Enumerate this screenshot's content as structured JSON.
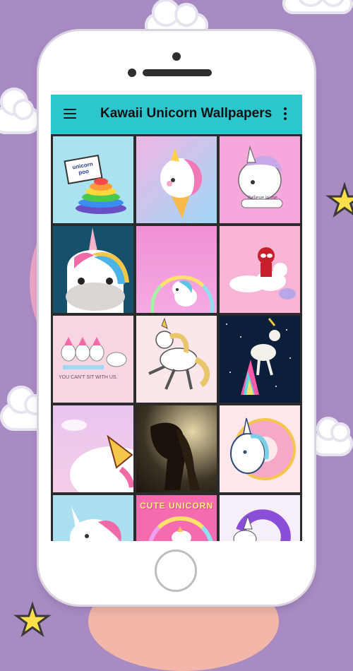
{
  "app": {
    "title": "Kawaii Unicorn Wallpapers"
  },
  "icons": {
    "menu": "hamburger-menu-icon",
    "more": "more-vert-icon"
  },
  "colors": {
    "background": "#a98bc4",
    "appbar": "#2cc6cf",
    "phone": "#ffffff"
  },
  "wallpapers": [
    {
      "name": "unicorn-poo",
      "sign_line1": "unicorn",
      "sign_line2": "poo",
      "bg": "#a9e3f0"
    },
    {
      "name": "unicorn-ice-cream",
      "bg": "#cfc4f2"
    },
    {
      "name": "unicorn-believe",
      "caption": "Believe in me",
      "bg": "#f6a7dc"
    },
    {
      "name": "unicorn-face-rainbow-mane",
      "bg": "#16506b"
    },
    {
      "name": "baby-unicorn-rainbow",
      "bg": "#f191d4"
    },
    {
      "name": "deadpool-unicorn",
      "bg": "#f8b4d5"
    },
    {
      "name": "unicorn-squad",
      "caption": "YOU CAN'T SIT WITH US.",
      "bg": "#f8d5e3"
    },
    {
      "name": "dancing-unicorn",
      "bg": "#fbe6ea"
    },
    {
      "name": "rainbow-unicorn-space",
      "bg": "#0c1f3a"
    },
    {
      "name": "unicorn-horn-clouds",
      "bg": "#f1c6e8"
    },
    {
      "name": "dark-horse",
      "bg": "#3a3224"
    },
    {
      "name": "unicorn-donut",
      "bg": "#fde7ea"
    },
    {
      "name": "unicorn-blue-mane",
      "bg": "#a9dfee"
    },
    {
      "name": "cute-unicorn",
      "caption": "CUTE UNICORN",
      "bg": "#f46bb0"
    },
    {
      "name": "purple-mane-unicorn",
      "bg": "#f6eef8"
    }
  ]
}
